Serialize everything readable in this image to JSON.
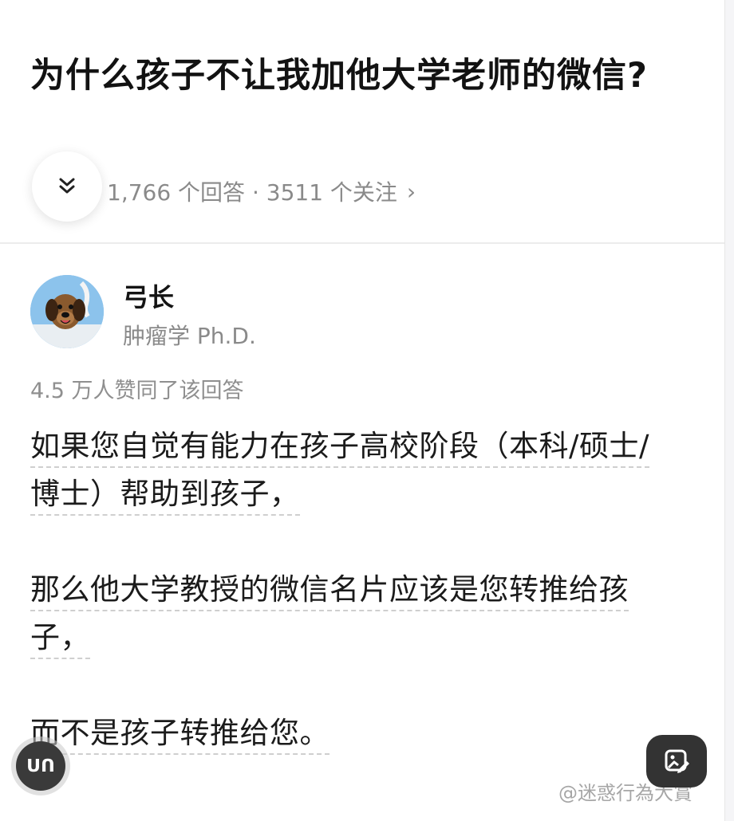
{
  "question": {
    "title": "为什么孩子不让我加他大学老师的微信?",
    "stats": "1,766 个回答 · 3511 个关注",
    "stats_chevron": "›"
  },
  "answer": {
    "author_name": "弓长",
    "author_bio": "肿瘤学 Ph.D.",
    "likes": "4.5 万人赞同了该回答",
    "paragraphs": [
      "如果您自觉有能力在孩子高校阶段（本科/硕士/博士）帮助到孩子，",
      "那么他大学教授的微信名片应该是您转推给孩子，",
      "而不是孩子转推给您。"
    ]
  },
  "floating": {
    "left_badge": "ᑌᑎ",
    "right_button_icon": "image-edit-icon"
  },
  "watermark": "@迷惑行為大賞",
  "icons": {
    "expand": "double-chevron-down-icon",
    "avatar": "dog-avatar"
  },
  "colors": {
    "text": "#1b1b1b",
    "muted": "#8a8a8a",
    "divider": "#ececec",
    "float_dark": "#333333"
  }
}
